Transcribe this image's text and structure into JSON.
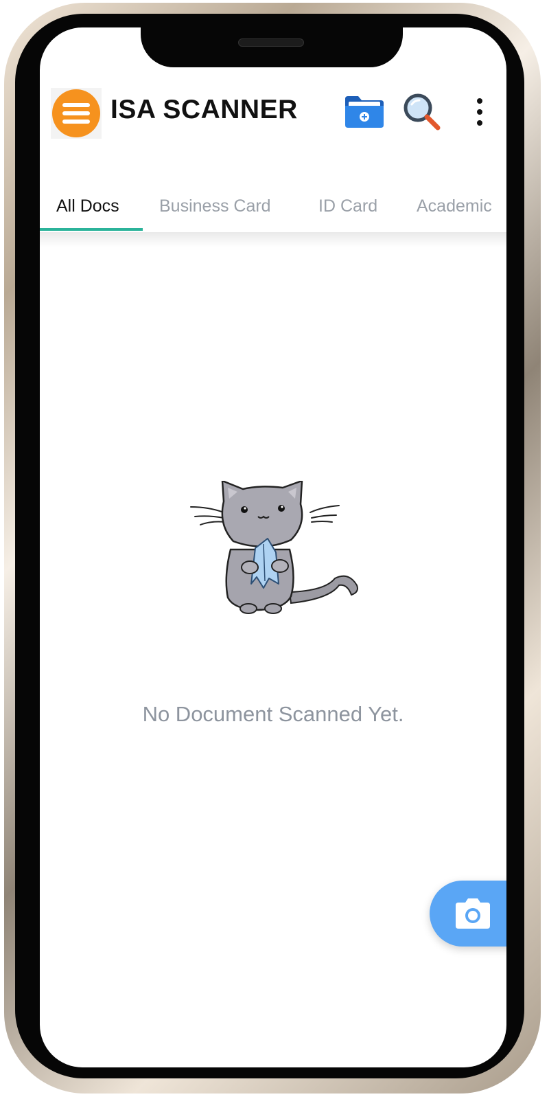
{
  "app": {
    "title": "ISA SCANNER"
  },
  "toolbar": {
    "menu_icon": "hamburger-menu-icon",
    "new_folder_icon": "folder-add-icon",
    "search_icon": "search-icon",
    "more_icon": "more-vertical-icon"
  },
  "tabs": [
    {
      "label": "All Docs",
      "active": true
    },
    {
      "label": "Business Card",
      "active": false
    },
    {
      "label": "ID Card",
      "active": false
    },
    {
      "label": "Academic",
      "active": false
    }
  ],
  "empty_state": {
    "illustration": "cat-holding-paper-illustration",
    "message": "No Document Scanned Yet."
  },
  "fab": {
    "icon": "camera-icon"
  },
  "colors": {
    "menu_accent": "#f6921e",
    "tab_indicator": "#2bb39a",
    "fab": "#5aa6f5",
    "folder": "#2f86e8",
    "empty_text": "#8d949e"
  }
}
